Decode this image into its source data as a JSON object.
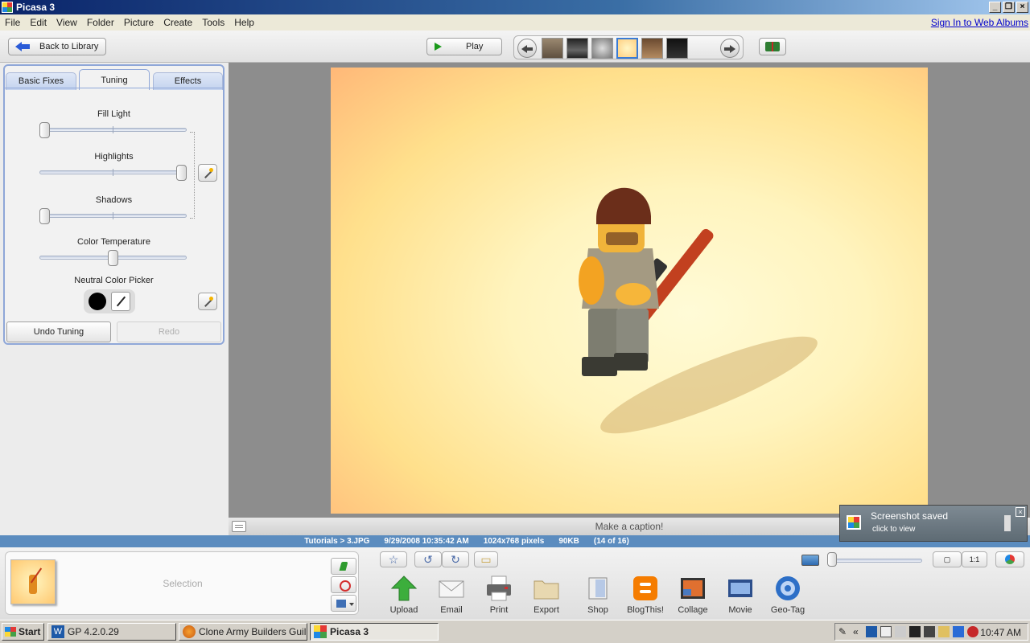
{
  "window": {
    "title": "Picasa 3",
    "minimize": "_",
    "restore": "❐",
    "close": "×"
  },
  "menu": {
    "items": [
      "File",
      "Edit",
      "View",
      "Folder",
      "Picture",
      "Create",
      "Tools",
      "Help"
    ],
    "signin": "Sign In to Web Albums"
  },
  "toolbar": {
    "back_label": "Back to Library",
    "play_label": "Play"
  },
  "filmstrip": {
    "thumbs": [
      "thumb-1",
      "thumb-2",
      "thumb-3",
      "thumb-4",
      "thumb-5",
      "thumb-6"
    ],
    "selected_index": 3
  },
  "tabs": {
    "basic": "Basic Fixes",
    "tuning": "Tuning",
    "effects": "Effects",
    "active": "Tuning"
  },
  "tuning": {
    "fill_light": {
      "label": "Fill Light",
      "value": 0.0
    },
    "highlights": {
      "label": "Highlights",
      "value": 1.0
    },
    "shadows": {
      "label": "Shadows",
      "value": 0.0
    },
    "color_temperature": {
      "label": "Color Temperature",
      "value": 0.5
    },
    "neutral_picker": {
      "label": "Neutral Color Picker",
      "color": "#000000"
    },
    "undo_label": "Undo Tuning",
    "redo_label": "Redo"
  },
  "caption": {
    "placeholder": "Make a caption!"
  },
  "status": {
    "path": "Tutorials > 3.JPG",
    "date": "9/29/2008 10:35:42 AM",
    "dimensions": "1024x768 pixels",
    "size": "90KB",
    "position": "(14 of 16)"
  },
  "selection": {
    "label": "Selection"
  },
  "actions": [
    {
      "label": "Upload",
      "icon": "upload-icon"
    },
    {
      "label": "Email",
      "icon": "email-icon"
    },
    {
      "label": "Print",
      "icon": "print-icon"
    },
    {
      "label": "Export",
      "icon": "export-icon"
    },
    {
      "label": "Shop",
      "icon": "shop-icon"
    },
    {
      "label": "BlogThis!",
      "icon": "blogger-icon"
    },
    {
      "label": "Collage",
      "icon": "collage-icon"
    },
    {
      "label": "Movie",
      "icon": "movie-icon"
    },
    {
      "label": "Geo-Tag",
      "icon": "geotag-icon"
    }
  ],
  "view_buttons": {
    "fit": "▢",
    "actual": "1:1"
  },
  "zoom": {
    "value": 0.0
  },
  "notification": {
    "title": "Screenshot saved",
    "subtitle": "click to view",
    "close": "×"
  },
  "taskbar": {
    "start": "Start",
    "tasks": [
      "GP 4.2.0.29",
      "Clone Army Builders Guil...",
      "Picasa 3"
    ],
    "active": "Picasa 3",
    "clock": "10:47 AM",
    "chevron": "«"
  },
  "colors": {
    "accent": "#5b8cbf",
    "panel_border": "#8fa7d8",
    "title_bar": "#0a246a"
  }
}
